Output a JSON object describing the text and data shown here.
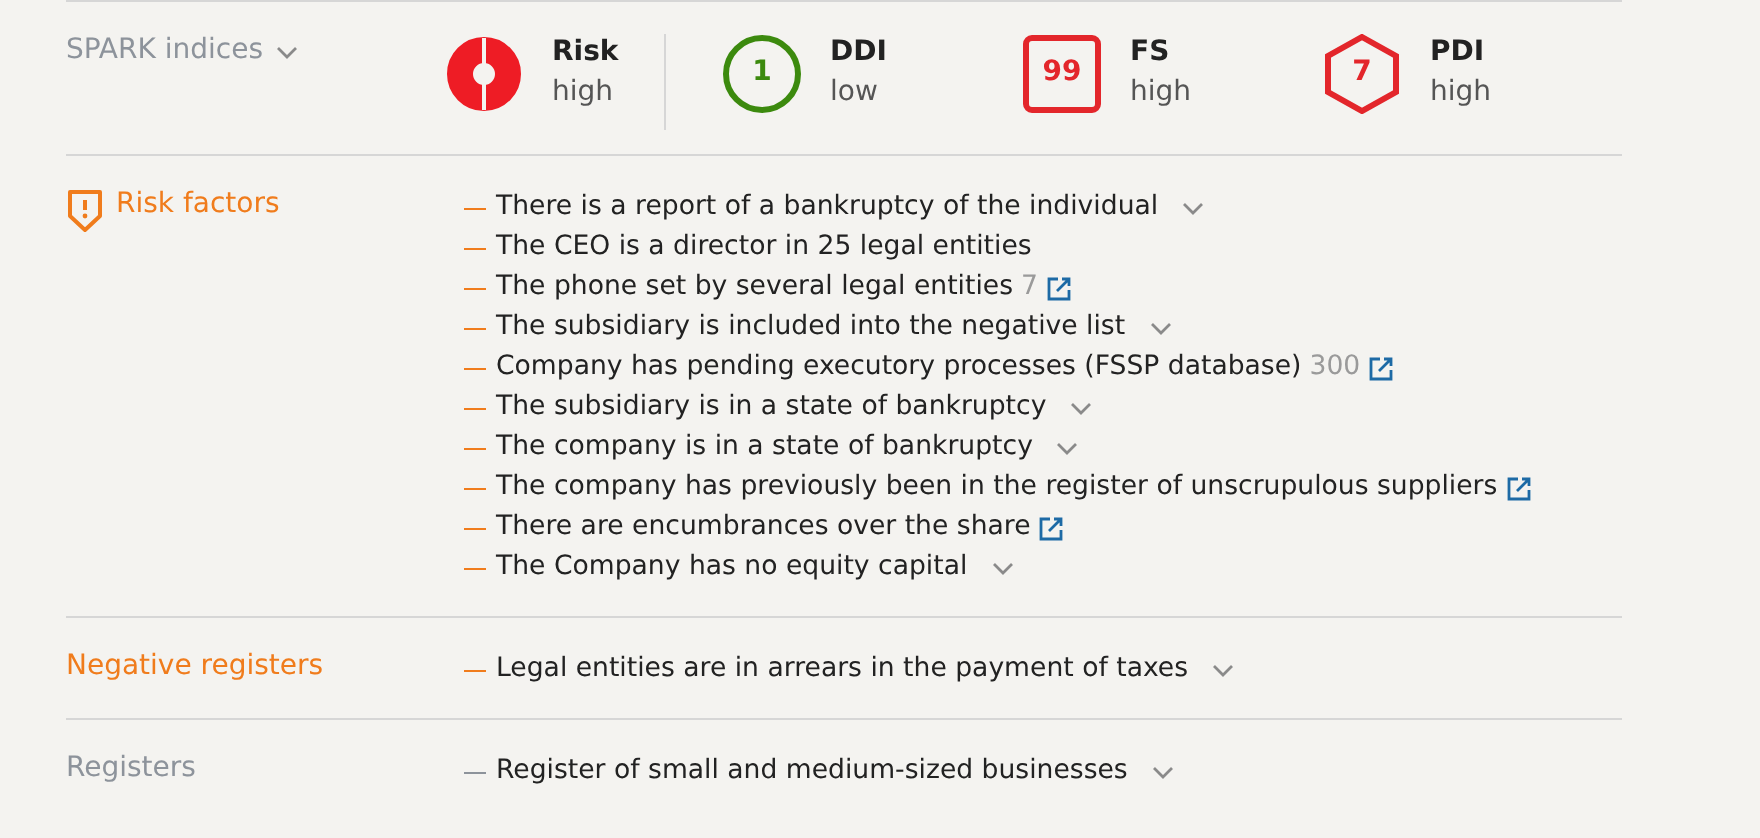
{
  "indices": {
    "label": "SPARK indices",
    "items": [
      {
        "kind": "donut",
        "value": "",
        "name": "Risk",
        "rating": "high",
        "color": "#ee1c25"
      },
      {
        "kind": "circle",
        "value": "1",
        "name": "DDI",
        "rating": "low",
        "color": "#3c8a0e"
      },
      {
        "kind": "square",
        "value": "99",
        "name": "FS",
        "rating": "high",
        "color": "#e3262b"
      },
      {
        "kind": "hexagon",
        "value": "7",
        "name": "PDI",
        "rating": "high",
        "color": "#e3262b"
      }
    ]
  },
  "sections": [
    {
      "title": "Risk factors",
      "kind": "alert",
      "items": [
        {
          "text": "There is a report of a bankruptcy of the individual",
          "expandable": true,
          "link": false
        },
        {
          "text": "The CEO is a director in 25 legal entities",
          "expandable": false,
          "link": false
        },
        {
          "text": "The phone set by several legal entities",
          "count": "7",
          "expandable": false,
          "link": true
        },
        {
          "text": "The subsidiary is included into the negative list",
          "expandable": true,
          "link": false
        },
        {
          "text": "Company has pending executory processes (FSSP database)",
          "count": "300",
          "expandable": false,
          "link": true
        },
        {
          "text": "The subsidiary is in a state of bankruptcy",
          "expandable": true,
          "link": false
        },
        {
          "text": "The company is in a state of bankruptcy",
          "expandable": true,
          "link": false
        },
        {
          "text": "The company has previously been in the register of unscrupulous suppliers",
          "expandable": false,
          "link": true
        },
        {
          "text": "There are encumbrances over the share",
          "expandable": false,
          "link": true
        },
        {
          "text": "The Company has no equity capital",
          "expandable": true,
          "link": false
        }
      ]
    },
    {
      "title": "Negative registers",
      "kind": "warning",
      "items": [
        {
          "text": "Legal entities are in arrears in the payment of taxes",
          "expandable": true,
          "link": false
        }
      ]
    },
    {
      "title": "Registers",
      "kind": "neutral",
      "items": [
        {
          "text": "Register of small and medium-sized businesses",
          "expandable": true,
          "link": false
        }
      ]
    }
  ]
}
